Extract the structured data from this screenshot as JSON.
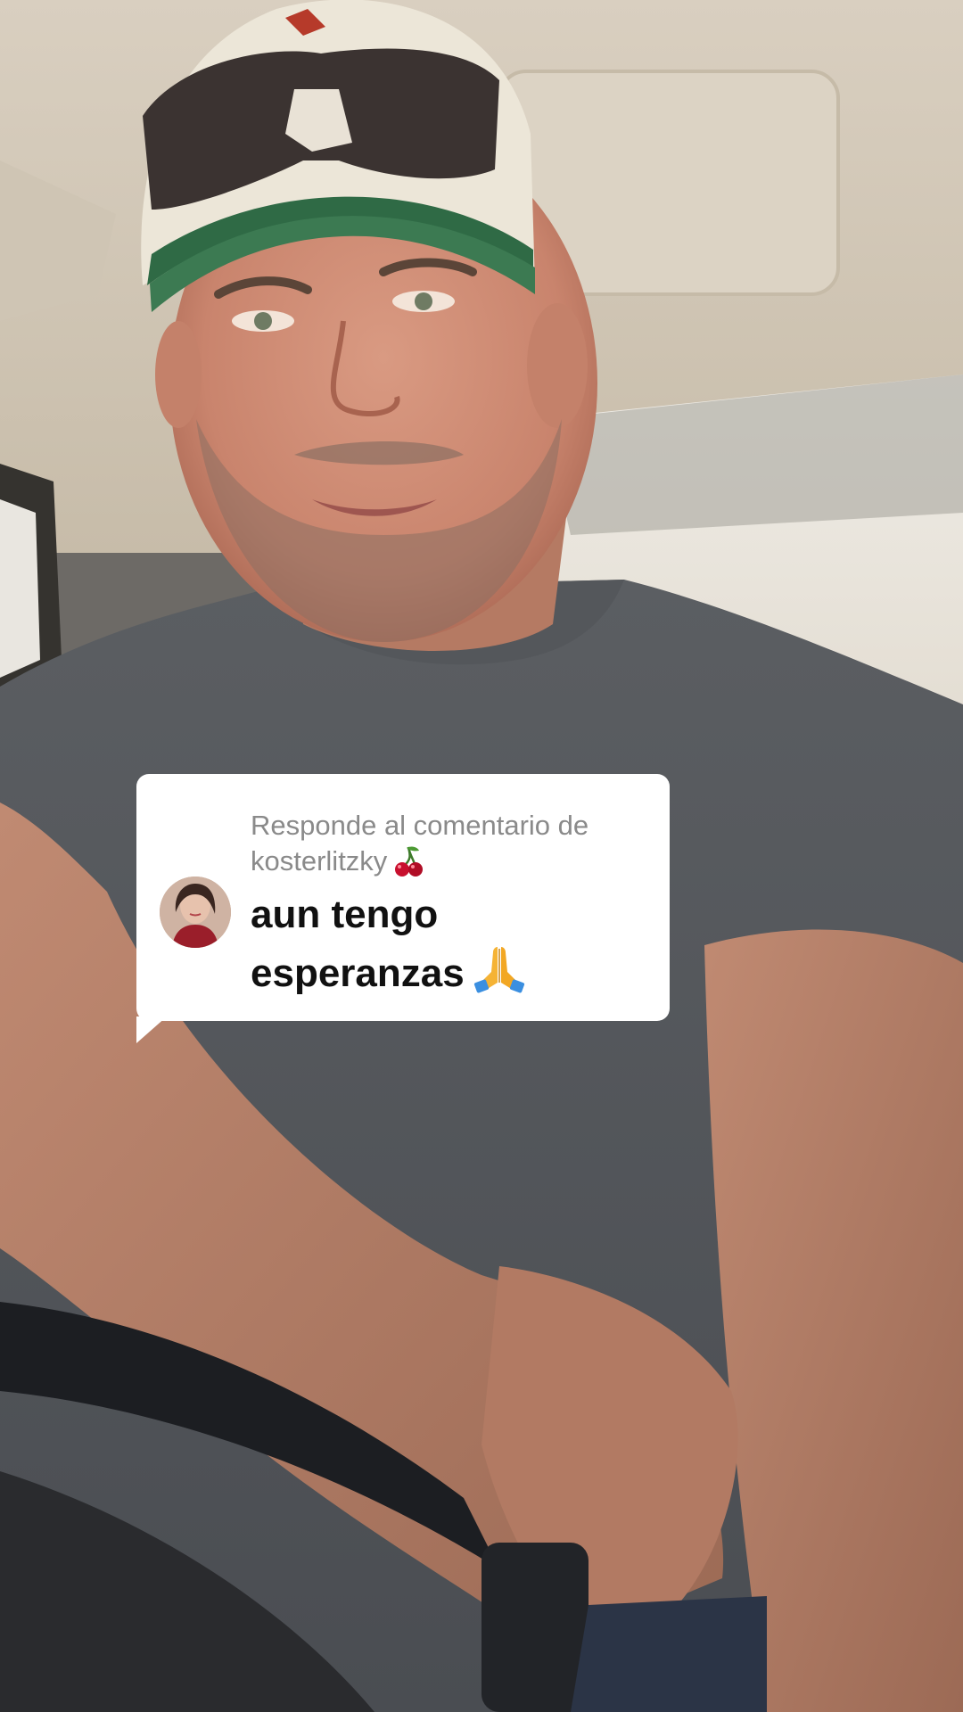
{
  "reply_sticker": {
    "header_prefix": "Responde al comentario de",
    "username": "kosterlitzky",
    "username_emoji_icon": "cherries-icon",
    "comment_line1": "aun tengo",
    "comment_line2": "esperanzas",
    "comment_emoji_icon": "folded-hands-icon"
  }
}
